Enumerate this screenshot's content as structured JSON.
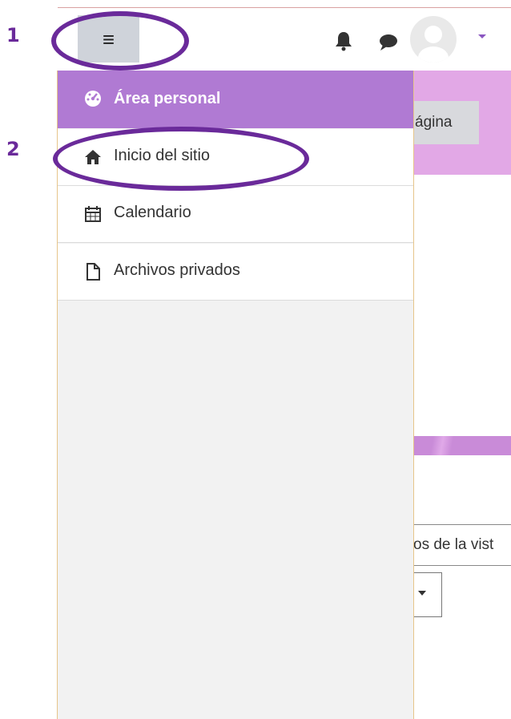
{
  "steps": {
    "one": "1",
    "two": "2"
  },
  "navbar": {
    "menu_icon": "hamburger-icon",
    "bell_icon": "bell-icon",
    "chat_icon": "chat-icon",
    "avatar_icon": "user-avatar-icon",
    "caret_icon": "caret-down-icon"
  },
  "background_page": {
    "button_label": "ágina",
    "select_text": "os de la vist"
  },
  "drawer": {
    "items": [
      {
        "label": "Área personal",
        "icon": "dashboard-icon",
        "active": true
      },
      {
        "label": "Inicio del sitio",
        "icon": "home-icon",
        "active": false
      },
      {
        "label": "Calendario",
        "icon": "calendar-icon",
        "active": false
      },
      {
        "label": "Archivos privados",
        "icon": "file-icon",
        "active": false
      }
    ]
  },
  "colors": {
    "accent_purple": "#b07ad3",
    "annotation_purple": "#6a2a9a",
    "banner_pink": "#e2a8e6"
  }
}
